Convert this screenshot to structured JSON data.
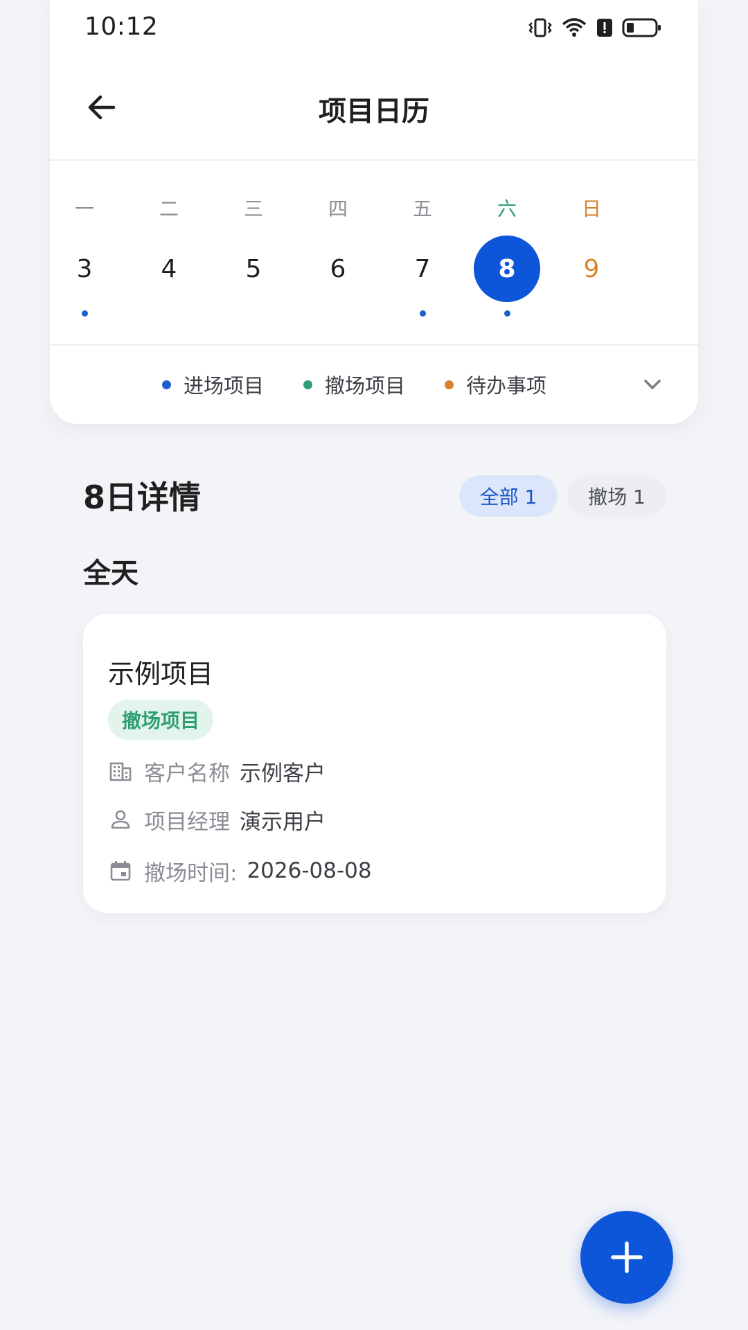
{
  "status_bar": {
    "time": "10:12",
    "icons": [
      "vibrate-icon",
      "wifi-icon",
      "alert-icon",
      "battery-icon"
    ]
  },
  "header": {
    "title": "项目日历",
    "back_icon": "arrow-left-icon"
  },
  "week": {
    "days": [
      {
        "name": "一",
        "number": "3",
        "has_dot": true
      },
      {
        "name": "二",
        "number": "4",
        "has_dot": false
      },
      {
        "name": "三",
        "number": "5",
        "has_dot": false
      },
      {
        "name": "四",
        "number": "6",
        "has_dot": false
      },
      {
        "name": "五",
        "number": "7",
        "has_dot": true
      },
      {
        "name": "六",
        "number": "8",
        "has_dot": true,
        "selected": true
      },
      {
        "name": "日",
        "number": "9",
        "has_dot": false
      }
    ]
  },
  "legend": {
    "items": [
      {
        "label": "进场项目",
        "color": "#1d5fd1"
      },
      {
        "label": "撤场项目",
        "color": "#2e9f74"
      },
      {
        "label": "待办事项",
        "color": "#d9822b"
      }
    ],
    "expand_icon": "chevron-down-icon"
  },
  "detail": {
    "title": "8日详情",
    "filters": [
      {
        "label": "全部 1",
        "active": true
      },
      {
        "label": "撤场 1",
        "active": false
      }
    ],
    "section_label": "全天"
  },
  "card": {
    "title": "示例项目",
    "tag": "撤场项目",
    "rows": [
      {
        "icon": "building-icon",
        "label": "客户名称",
        "value": "示例客户"
      },
      {
        "icon": "person-icon",
        "label": "项目经理",
        "value": "演示用户"
      },
      {
        "icon": "calendar-icon",
        "label": "撤场时间:",
        "value": "2026-08-08"
      }
    ]
  },
  "fab": {
    "icon": "plus-icon"
  },
  "colors": {
    "primary": "#0d56d9",
    "green": "#2e9f74",
    "orange": "#d9822b",
    "background": "#f3f4f8"
  }
}
